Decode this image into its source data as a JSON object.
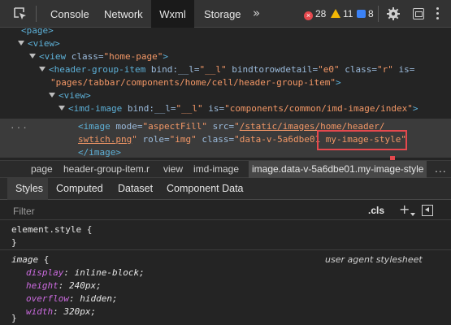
{
  "toolbar": {
    "tabs": [
      {
        "label": "Console",
        "active": false
      },
      {
        "label": "Network",
        "active": false
      },
      {
        "label": "Wxml",
        "active": true
      },
      {
        "label": "Storage",
        "active": false
      }
    ],
    "more_tabs": "»",
    "errors": "28",
    "warnings": "11",
    "info": "8",
    "icons": [
      "inspect-element-icon",
      "error-icon",
      "warning-icon",
      "info-icon",
      "gear-icon",
      "dock-icon",
      "kebab-menu-icon"
    ]
  },
  "tree": {
    "lines": {
      "page": "<page>",
      "view": "<view>",
      "home_open": "<view",
      "home_attr": "class=",
      "home_val": "\"home-page\"",
      "home_close": ">",
      "hgi_open": "<header-group-item",
      "hgi_attr1": "bind:__l=",
      "hgi_val1": "\"__l\"",
      "hgi_attr2": "bindtorowdetail=",
      "hgi_val2": "\"e0\"",
      "hgi_attr3": "class=",
      "hgi_val3": "\"r\"",
      "hgi_attr4": "is=",
      "hgi_val4_a": "\"",
      "hgi_val4_b": "pages/tabbar/components/home/cell/header-group-item\"",
      "hgi_close": ">",
      "view2": "<view>",
      "imd_open": "<imd-image",
      "imd_attr1": "bind:__l=",
      "imd_val1": "\"__l\"",
      "imd_attr2": "is=",
      "imd_val2": "\"components/common/imd-image/index\"",
      "imd_close": ">",
      "img_open": "<image",
      "img_attr1": "mode=",
      "img_val1": "\"aspectFill\"",
      "img_attr2": "src=",
      "img_val2_q": "\"",
      "img_val2_a": "/static/images/home/header/",
      "img_val2_b": "swtich.png",
      "img_val2_q2": "\"",
      "img_attr3": "role=",
      "img_val3": "\"img\"",
      "img_attr4": "class=",
      "img_val4_a": "\"data-v-5a6dbe01",
      "img_val4_b": "my-image-style\"",
      "img_end": "</image>"
    },
    "dots": "..."
  },
  "breadcrumb": {
    "items": [
      "page",
      "header-group-item.r",
      "view",
      "imd-image",
      "image.data-v-5a6dbe01.my-image-style"
    ],
    "more": "..."
  },
  "subtabs": {
    "items": [
      "Styles",
      "Computed",
      "Dataset",
      "Component Data"
    ],
    "active": "Styles"
  },
  "filter": {
    "placeholder": "Filter",
    "cls": ".cls",
    "plus": "+"
  },
  "styles": {
    "element_style_open": "element.style {",
    "element_style_close": "}",
    "rule_selector": "image",
    "rule_open": " {",
    "rule_source": "user agent stylesheet",
    "declarations": [
      {
        "prop": "display",
        "value": "inline-block;"
      },
      {
        "prop": "height",
        "value": "240px;"
      },
      {
        "prop": "overflow",
        "value": "hidden;"
      },
      {
        "prop": "width",
        "value": "320px;"
      }
    ],
    "rule_close": "}"
  },
  "colors": {
    "tag": "#5db0d7",
    "attr": "#9bbbdc",
    "value": "#f29766",
    "css_prop": "#cc6be0",
    "highlight": "#e5484d"
  }
}
